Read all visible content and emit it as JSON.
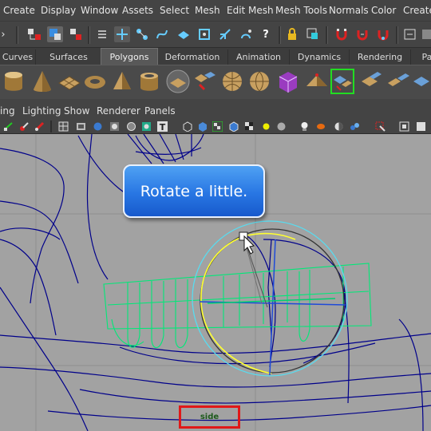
{
  "menubar": {
    "items": [
      "Create",
      "Display",
      "Window",
      "Assets",
      "Select",
      "Mesh",
      "Edit Mesh",
      "Mesh Tools",
      "Normals",
      "Color",
      "Create"
    ]
  },
  "shelf_tabs": {
    "items": [
      "Curves",
      "Surfaces",
      "Polygons",
      "Deformation",
      "Animation",
      "Dynamics",
      "Rendering",
      "Pa"
    ],
    "active": "Polygons"
  },
  "panel_menu": {
    "items": [
      "ing",
      "Lighting",
      "Show",
      "Renderer",
      "Panels"
    ]
  },
  "callout": {
    "text": "Rotate a little."
  },
  "viewport": {
    "camera_label": "side"
  },
  "colors": {
    "menu_bg": "#444444",
    "viewport_bg": "#a2a2a2",
    "wire_dark": "#000080",
    "wire_green": "#00ff80",
    "wire_cyan": "#50e0f0",
    "highlight_yellow": "#ffff40",
    "callout_blue": "#2876e3",
    "frame_red": "#e01818"
  },
  "icons": {
    "status_line": [
      "chevron-icon",
      "select-by-hierarchy-icon",
      "select-by-object-icon",
      "select-by-component-icon",
      "menu-collapse-icon",
      "move-snap-icon",
      "snap-curve-icon",
      "snap-point-icon",
      "snap-plane-icon",
      "snap-view-icon",
      "snap-live-icon",
      "help-icon",
      "lock-icon",
      "select-icon",
      "magnet-a-icon",
      "magnet-b-icon",
      "magnet-c-icon",
      "history-icon",
      "render-icon"
    ],
    "shelf": [
      "cylinder-icon",
      "cone-icon",
      "plane-icon",
      "torus-icon",
      "pyramid-icon",
      "pipe-icon",
      "sphere-icon",
      "cube-icon",
      "soccer-ball-icon",
      "sphere-alt-icon",
      "sphere-alt2-icon",
      "platonic-icon",
      "prism-icon",
      "extrude-icon",
      "bridge-icon",
      "append-icon"
    ],
    "panel_toolbar": [
      "camera-icon",
      "tool-icon",
      "brush-icon",
      "grid-icon",
      "film-icon",
      "wire-icon",
      "smooth-icon",
      "xray-icon",
      "texture-icon",
      "light-icon",
      "text-icon",
      "cube-wire-icon",
      "cube-shade-icon",
      "cube-tex-icon",
      "checker-icon",
      "sun-icon",
      "sphere-icon",
      "bulb-icon",
      "fish-icon",
      "half-icon",
      "beads-icon",
      "select-icon",
      "cube-a-icon",
      "cube-b-icon"
    ]
  }
}
